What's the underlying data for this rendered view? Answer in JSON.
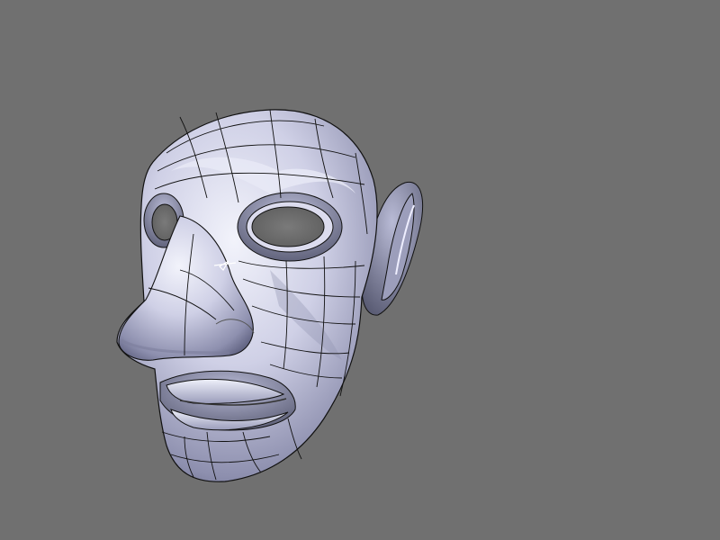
{
  "viewport": {
    "background": "#707070",
    "object": {
      "name": "sculpted-head-mesh",
      "shading": "smooth",
      "wireframe": true,
      "surface_color": "#cfd0e6",
      "shadow_color": "#6f7190",
      "wire_color": "#111111"
    }
  }
}
